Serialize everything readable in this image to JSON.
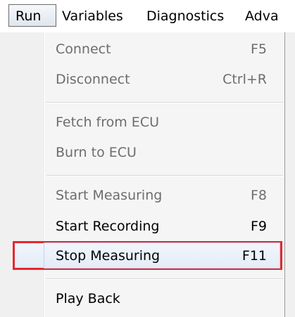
{
  "menubar": {
    "items": [
      {
        "label": "Run",
        "active": true
      },
      {
        "label": "Variables"
      },
      {
        "label": "Diagnostics"
      },
      {
        "label": "Adva"
      }
    ]
  },
  "run_menu": {
    "groups": [
      [
        {
          "label": "Connect",
          "shortcut": "F5",
          "enabled": false
        },
        {
          "label": "Disconnect",
          "shortcut": "Ctrl+R",
          "enabled": false
        }
      ],
      [
        {
          "label": "Fetch from ECU",
          "shortcut": "",
          "enabled": false
        },
        {
          "label": "Burn to ECU",
          "shortcut": "",
          "enabled": false
        }
      ],
      [
        {
          "label": "Start Measuring",
          "shortcut": "F8",
          "enabled": false
        },
        {
          "label": "Start Recording",
          "shortcut": "F9",
          "enabled": true
        },
        {
          "label": "Stop Measuring",
          "shortcut": "F11",
          "enabled": true,
          "highlighted": true
        }
      ],
      [
        {
          "label": "Play Back",
          "shortcut": "",
          "enabled": true
        }
      ]
    ]
  },
  "colors": {
    "highlight_border": "#e8262e",
    "disabled_text": "#6d6d6d",
    "enabled_text": "#000000"
  }
}
